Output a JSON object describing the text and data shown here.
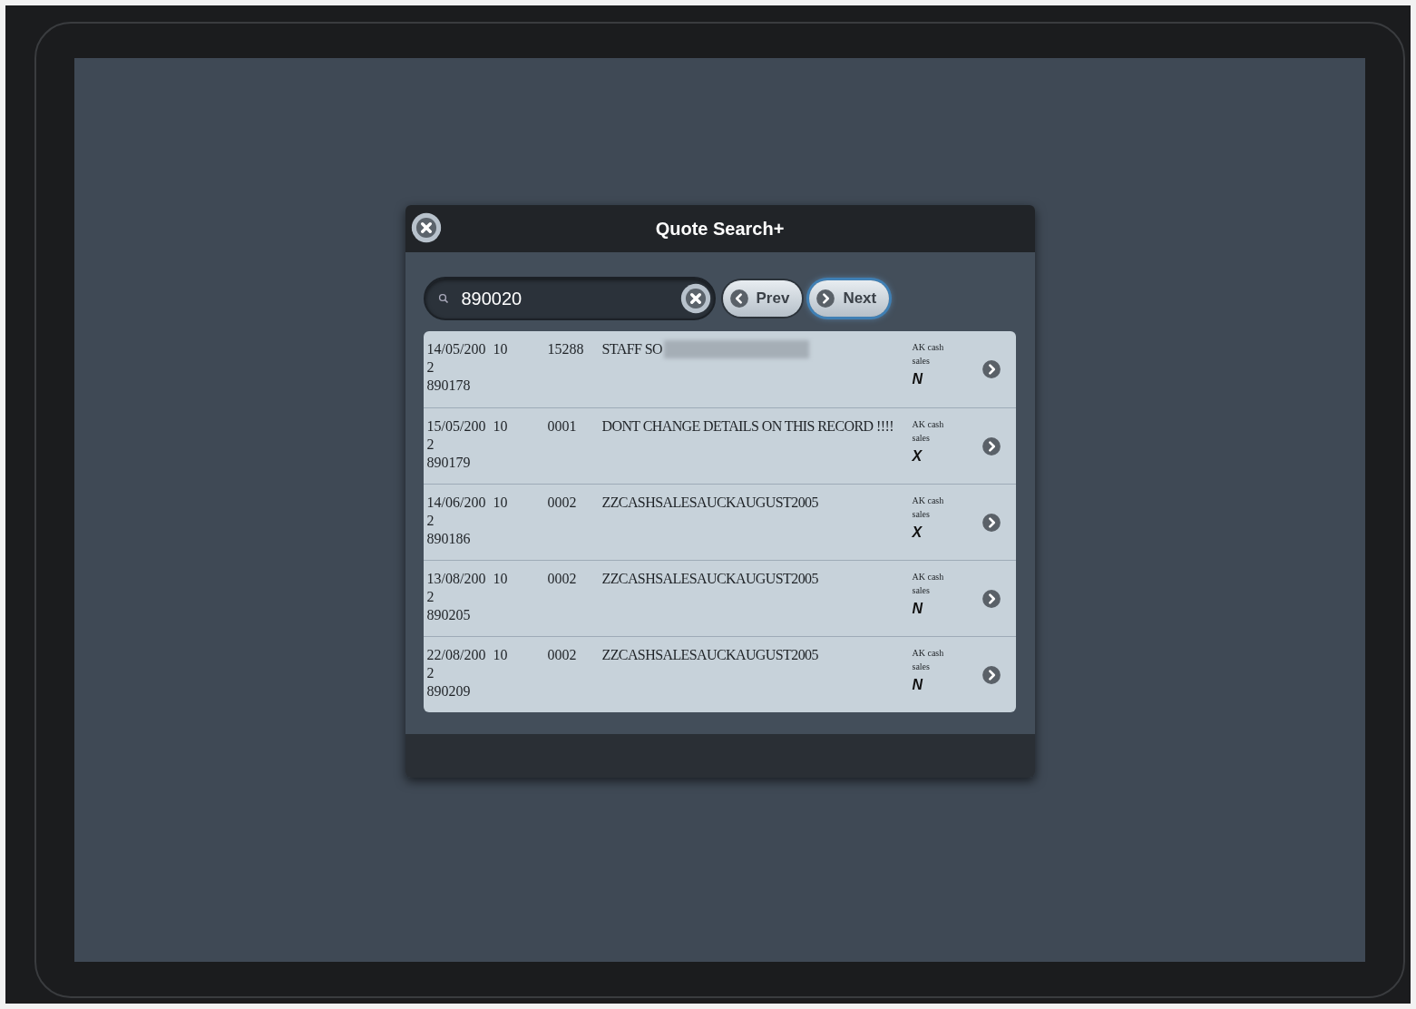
{
  "dialog": {
    "title": "Quote Search+"
  },
  "search": {
    "value": "890020"
  },
  "buttons": [
    {
      "label": "Prev",
      "kind": "prev",
      "selected": false
    },
    {
      "label": "Next",
      "kind": "next",
      "selected": true
    }
  ],
  "rows": [
    {
      "date": "14/05/200",
      "column_2": "10",
      "date_end": "2",
      "number": "890178",
      "code": "15288",
      "description": "STAFF SO",
      "redacted": true,
      "branch": "AK cash sales",
      "status": "N"
    },
    {
      "date": "15/05/200",
      "column_2": "10",
      "date_end": "2",
      "number": "890179",
      "code": "0001",
      "description": "DONT CHANGE DETAILS ON THIS RECORD !!!!",
      "redacted": false,
      "branch": "AK cash sales",
      "status": "X"
    },
    {
      "date": "14/06/200",
      "column_2": "10",
      "date_end": "2",
      "number": "890186",
      "code": "0002",
      "description": "ZZCASHSALESAUCKAUGUST2005",
      "redacted": false,
      "branch": "AK cash sales",
      "status": "X"
    },
    {
      "date": "13/08/200",
      "column_2": "10",
      "date_end": "2",
      "number": "890205",
      "code": "0002",
      "description": "ZZCASHSALESAUCKAUGUST2005",
      "redacted": false,
      "branch": "AK cash sales",
      "status": "N"
    },
    {
      "date": "22/08/200",
      "column_2": "10",
      "date_end": "2",
      "number": "890209",
      "code": "0002",
      "description": "ZZCASHSALESAUCKAUGUST2005",
      "redacted": false,
      "branch": "AK cash sales",
      "status": "N"
    }
  ]
}
